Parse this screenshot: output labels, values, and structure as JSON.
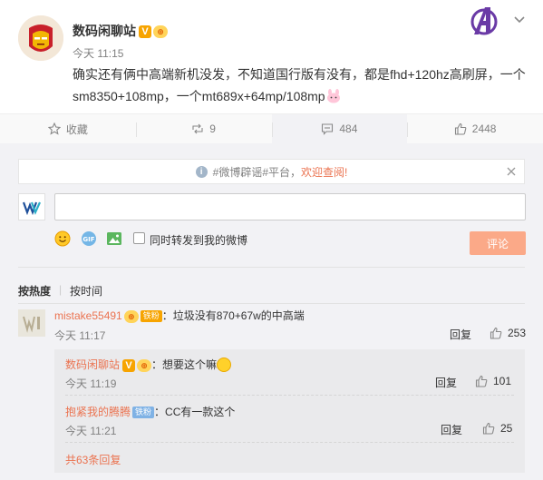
{
  "post": {
    "author": "数码闲聊站",
    "verified_badge": "V",
    "medal_badge": "⊕",
    "time": "今天 11:15",
    "text": "确实还有俩中高端新机没发，不知道国行版有没有，都是fhd+120hz高刷屏，一个sm8350+108mp，一个mt689x+64mp/108mp"
  },
  "actions": {
    "favorite_label": "收藏",
    "repost_count": "9",
    "comment_count": "484",
    "like_count": "2448"
  },
  "notice": {
    "info_icon": "i",
    "topic": "#微博辟谣#平台，",
    "welcome": "欢迎查阅!"
  },
  "composer": {
    "placeholder": "",
    "repost_label": "同时转发到我的微博",
    "submit_label": "评论"
  },
  "sort": {
    "hot_label": "按热度",
    "separator": "|",
    "time_label": "按时间"
  },
  "comments": [
    {
      "user": "mistake55491",
      "badge": "铁粉",
      "text": "：垃圾没有870+67w的中高端",
      "time": "今天 11:17",
      "reply_label": "回复",
      "likes": "253",
      "replies": [
        {
          "user": "数码闲聊站",
          "verified": "V",
          "text": "：想要这个嘛",
          "time": "今天 11:19",
          "reply_label": "回复",
          "likes": "101"
        },
        {
          "user": "抱紧我的腾腾",
          "badge": "铁粉",
          "text": "：CC有一款这个",
          "time": "今天 11:21",
          "reply_label": "回复",
          "likes": "25"
        }
      ],
      "more_replies": "共63条回复"
    }
  ],
  "colors": {
    "accent": "#eb7350",
    "submit_disabled": "#fba988",
    "muted": "#808080",
    "panel": "#f2f2f5"
  },
  "icons": [
    "avenger-logo-icon",
    "chevron-down-icon",
    "star-icon",
    "repost-icon",
    "comment-icon",
    "like-icon",
    "info-icon",
    "close-icon",
    "emoji-icon",
    "gif-icon",
    "image-icon"
  ]
}
